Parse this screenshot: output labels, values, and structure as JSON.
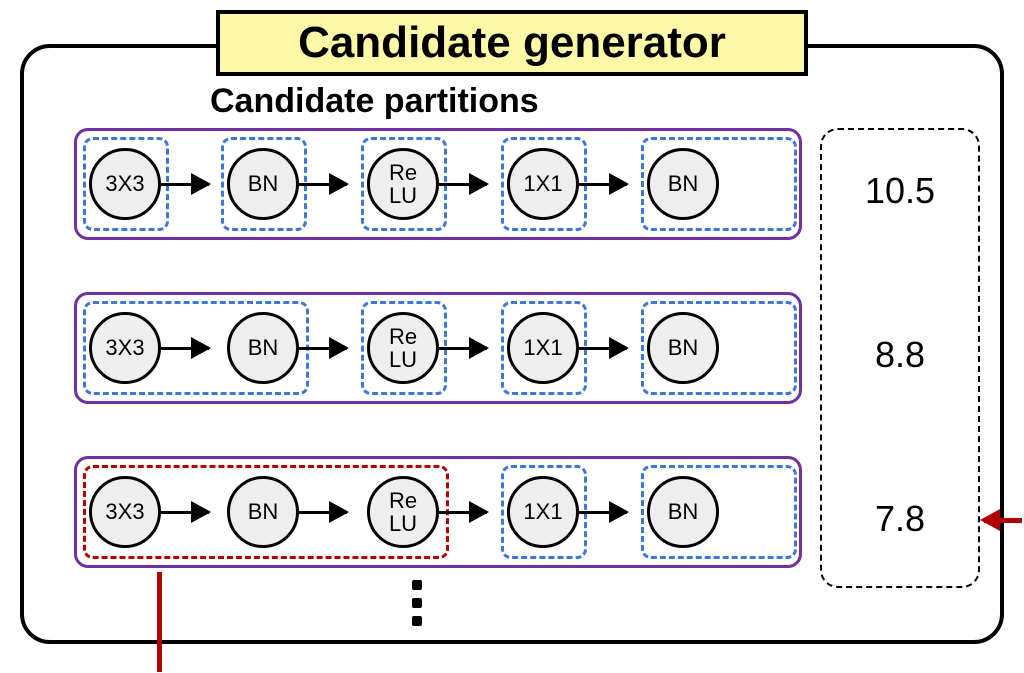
{
  "title": "Candidate generator",
  "subtitle": "Candidate partitions",
  "nodes": {
    "conv3": "3X3",
    "bn": "BN",
    "relu": "Re\nLU",
    "conv1": "1X1"
  },
  "scores": [
    "10.5",
    "8.8",
    "7.8"
  ]
}
